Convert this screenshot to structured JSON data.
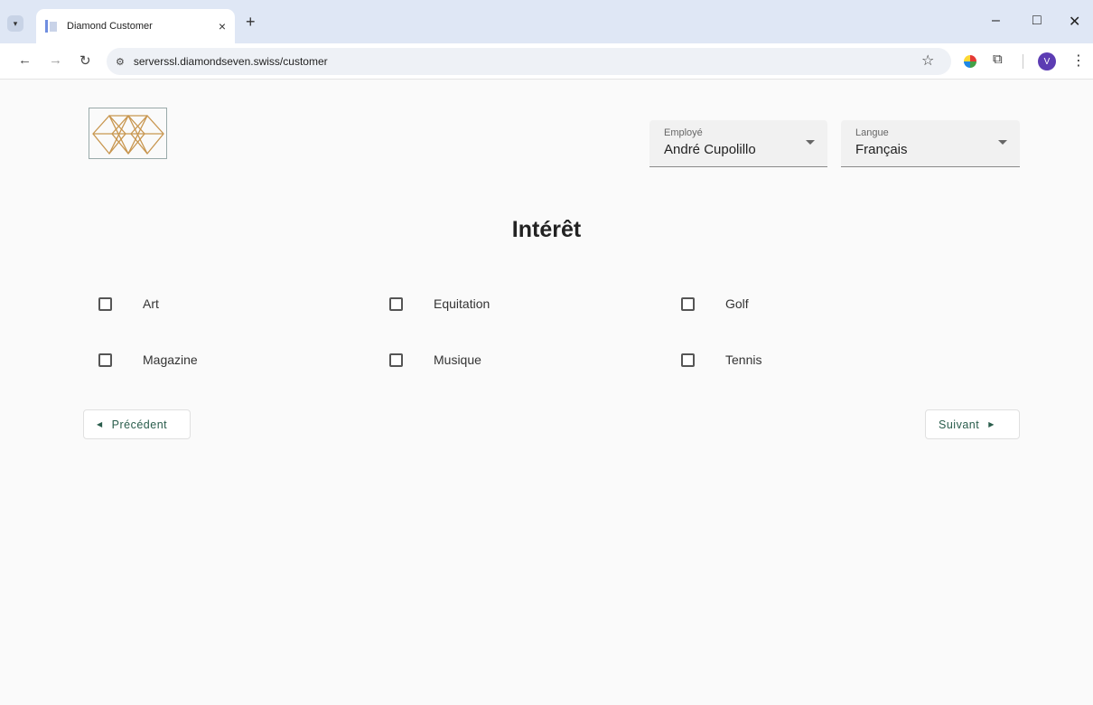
{
  "browser": {
    "tab_title": "Diamond Customer",
    "tab_close": "×",
    "new_tab": "+",
    "url": "serverssl.diamondseven.swiss/customer",
    "avatar_letter": "V",
    "controls": {
      "minimize": "–",
      "maximize": "□",
      "close": "✕"
    },
    "nav": {
      "back": "←",
      "forward": "→",
      "reload": "↻"
    }
  },
  "header": {
    "employee": {
      "label": "Employé",
      "value": "André Cupolillo"
    },
    "language": {
      "label": "Langue",
      "value": "Français"
    },
    "logo_color": "#c8964f"
  },
  "main": {
    "title": "Intérêt",
    "interests": [
      {
        "label": "Art",
        "checked": false
      },
      {
        "label": "Equitation",
        "checked": false
      },
      {
        "label": "Golf",
        "checked": false
      },
      {
        "label": "Magazine",
        "checked": false
      },
      {
        "label": "Musique",
        "checked": false
      },
      {
        "label": "Tennis",
        "checked": false
      }
    ],
    "prev_label": "Précédent",
    "next_label": "Suivant"
  },
  "colors": {
    "accent": "#2a5d4c",
    "avatar": "#5c3cb3"
  }
}
